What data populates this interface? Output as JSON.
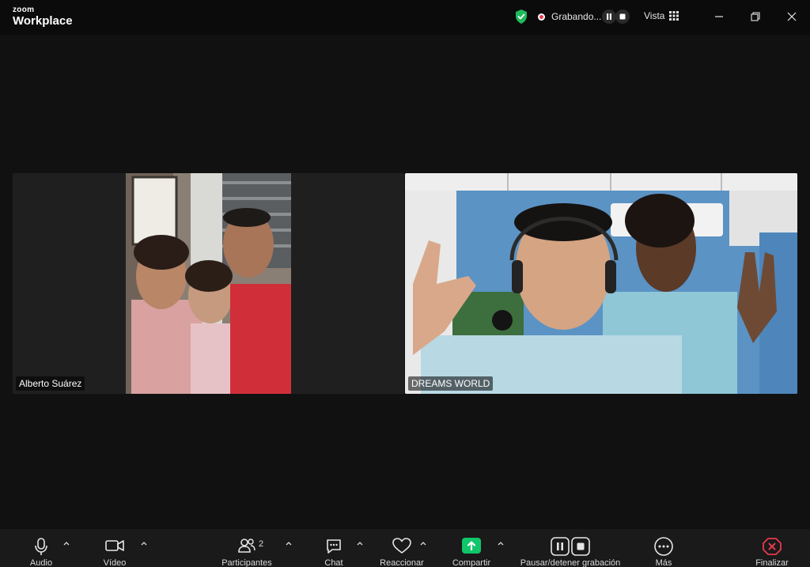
{
  "app": {
    "brand_small": "zoom",
    "brand_large": "Workplace"
  },
  "titlebar": {
    "recording_text": "Grabando...",
    "view_label": "Vista",
    "icons": {
      "security": "shield-check-icon",
      "view": "grid-icon",
      "minimize": "minimize-icon",
      "maximize": "restore-icon",
      "close": "close-icon"
    }
  },
  "participants": [
    {
      "name": "Alberto Suárez"
    },
    {
      "name": "DREAMS WORLD"
    }
  ],
  "toolbar": {
    "audio": "Audio",
    "video": "Vídeo",
    "participants": "Participantes",
    "participants_count": "2",
    "chat": "Chat",
    "react": "Reaccionar",
    "share": "Compartir",
    "recording": "Pausar/detener grabación",
    "more": "Más",
    "end": "Finalizar"
  },
  "colors": {
    "background": "#111111",
    "toolbar": "#1a1a1a",
    "share_green": "#10c56a",
    "end_red": "#e8384f",
    "shield_green": "#1fba5c"
  }
}
